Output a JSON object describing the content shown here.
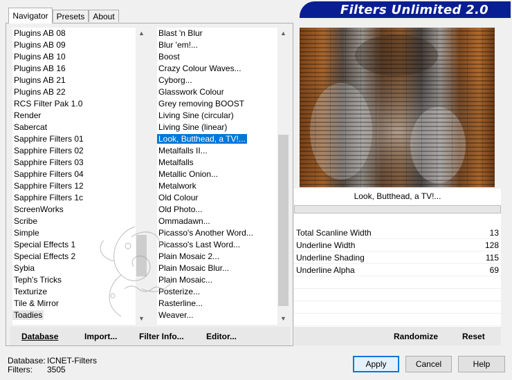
{
  "tabs": [
    {
      "label": "Navigator",
      "active": true
    },
    {
      "label": "Presets",
      "active": false
    },
    {
      "label": "About",
      "active": false
    }
  ],
  "banner": {
    "title": "Filters Unlimited 2.0",
    "color": "#0a1e94"
  },
  "categories": {
    "items": [
      "Plugins AB 08",
      "Plugins AB 09",
      "Plugins AB 10",
      "Plugins AB 16",
      "Plugins AB 21",
      "Plugins AB 22",
      "RCS Filter Pak 1.0",
      "Render",
      "Sabercat",
      "Sapphire Filters 01",
      "Sapphire Filters 02",
      "Sapphire Filters 03",
      "Sapphire Filters 04",
      "Sapphire Filters 12",
      "Sapphire Filters 1c",
      "ScreenWorks",
      "Scribe",
      "Simple",
      "Special Effects 1",
      "Special Effects 2",
      "Sybia",
      "Teph's Tricks",
      "Texturize",
      "Tile & Mirror",
      "Toadies"
    ],
    "selected": "Toadies"
  },
  "filters": {
    "items": [
      "Blast 'n Blur",
      "Blur 'em!...",
      "Boost",
      "Crazy Colour Waves...",
      "Cyborg...",
      "Glasswork Colour",
      "Grey removing BOOST",
      "Living Sine (circular)",
      "Living Sine (linear)",
      "Look, Butthead, a TV!...",
      "Metalfalls II...",
      "Metalfalls",
      "Metallic Onion...",
      "Metalwork",
      "Old Colour",
      "Old Photo...",
      "Ommadawn...",
      "Picasso's Another Word...",
      "Picasso's Last Word...",
      "Plain Mosaic 2...",
      "Plain Mosaic Blur...",
      "Plain Mosaic...",
      "Posterize...",
      "Rasterline...",
      "Weaver..."
    ],
    "selected": "Look, Butthead, a TV!..."
  },
  "preview": {
    "filter_name": "Look, Butthead, a TV!..."
  },
  "parameters": [
    {
      "label": "Total Scanline Width",
      "value": "13"
    },
    {
      "label": "Underline Width",
      "value": "128"
    },
    {
      "label": "Underline Shading",
      "value": "115"
    },
    {
      "label": "Underline Alpha",
      "value": "69"
    }
  ],
  "left_buttons": {
    "database": {
      "label": "Database",
      "underline": "D"
    },
    "import": {
      "label": "Import...",
      "underline": "I"
    },
    "filter_info": {
      "label": "Filter Info...",
      "underline": "F"
    },
    "editor": {
      "label": "Editor...",
      "underline": "E"
    }
  },
  "right_buttons": {
    "randomize": "Randomize",
    "reset": "Reset"
  },
  "status": {
    "database_label": "Database:",
    "database_value": "ICNET-Filters",
    "filters_label": "Filters:",
    "filters_value": "3505"
  },
  "dialog_buttons": {
    "apply": "Apply",
    "cancel": "Cancel",
    "help": "Help"
  }
}
